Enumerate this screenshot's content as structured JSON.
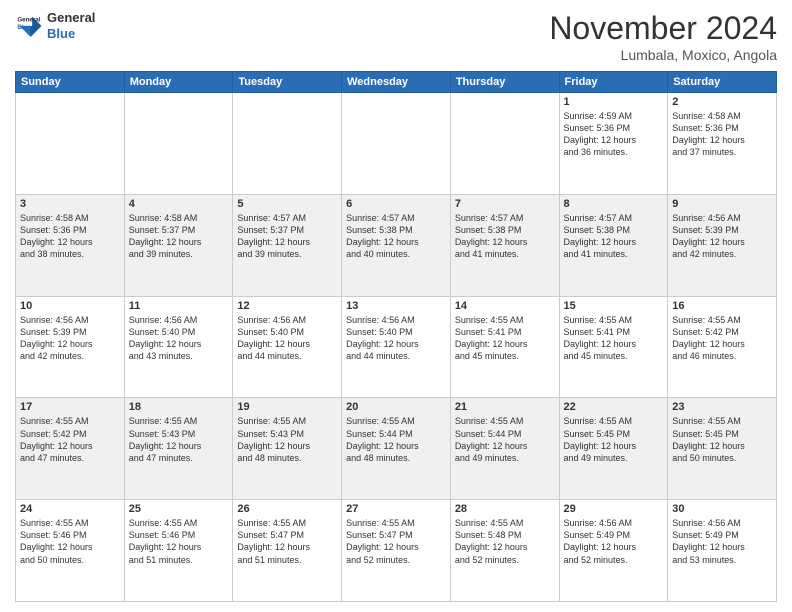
{
  "header": {
    "logo_line1": "General",
    "logo_line2": "Blue",
    "month": "November 2024",
    "location": "Lumbala, Moxico, Angola"
  },
  "weekdays": [
    "Sunday",
    "Monday",
    "Tuesday",
    "Wednesday",
    "Thursday",
    "Friday",
    "Saturday"
  ],
  "weeks": [
    [
      {
        "day": "",
        "info": ""
      },
      {
        "day": "",
        "info": ""
      },
      {
        "day": "",
        "info": ""
      },
      {
        "day": "",
        "info": ""
      },
      {
        "day": "",
        "info": ""
      },
      {
        "day": "1",
        "info": "Sunrise: 4:59 AM\nSunset: 5:36 PM\nDaylight: 12 hours\nand 36 minutes."
      },
      {
        "day": "2",
        "info": "Sunrise: 4:58 AM\nSunset: 5:36 PM\nDaylight: 12 hours\nand 37 minutes."
      }
    ],
    [
      {
        "day": "3",
        "info": "Sunrise: 4:58 AM\nSunset: 5:36 PM\nDaylight: 12 hours\nand 38 minutes."
      },
      {
        "day": "4",
        "info": "Sunrise: 4:58 AM\nSunset: 5:37 PM\nDaylight: 12 hours\nand 39 minutes."
      },
      {
        "day": "5",
        "info": "Sunrise: 4:57 AM\nSunset: 5:37 PM\nDaylight: 12 hours\nand 39 minutes."
      },
      {
        "day": "6",
        "info": "Sunrise: 4:57 AM\nSunset: 5:38 PM\nDaylight: 12 hours\nand 40 minutes."
      },
      {
        "day": "7",
        "info": "Sunrise: 4:57 AM\nSunset: 5:38 PM\nDaylight: 12 hours\nand 41 minutes."
      },
      {
        "day": "8",
        "info": "Sunrise: 4:57 AM\nSunset: 5:38 PM\nDaylight: 12 hours\nand 41 minutes."
      },
      {
        "day": "9",
        "info": "Sunrise: 4:56 AM\nSunset: 5:39 PM\nDaylight: 12 hours\nand 42 minutes."
      }
    ],
    [
      {
        "day": "10",
        "info": "Sunrise: 4:56 AM\nSunset: 5:39 PM\nDaylight: 12 hours\nand 42 minutes."
      },
      {
        "day": "11",
        "info": "Sunrise: 4:56 AM\nSunset: 5:40 PM\nDaylight: 12 hours\nand 43 minutes."
      },
      {
        "day": "12",
        "info": "Sunrise: 4:56 AM\nSunset: 5:40 PM\nDaylight: 12 hours\nand 44 minutes."
      },
      {
        "day": "13",
        "info": "Sunrise: 4:56 AM\nSunset: 5:40 PM\nDaylight: 12 hours\nand 44 minutes."
      },
      {
        "day": "14",
        "info": "Sunrise: 4:55 AM\nSunset: 5:41 PM\nDaylight: 12 hours\nand 45 minutes."
      },
      {
        "day": "15",
        "info": "Sunrise: 4:55 AM\nSunset: 5:41 PM\nDaylight: 12 hours\nand 45 minutes."
      },
      {
        "day": "16",
        "info": "Sunrise: 4:55 AM\nSunset: 5:42 PM\nDaylight: 12 hours\nand 46 minutes."
      }
    ],
    [
      {
        "day": "17",
        "info": "Sunrise: 4:55 AM\nSunset: 5:42 PM\nDaylight: 12 hours\nand 47 minutes."
      },
      {
        "day": "18",
        "info": "Sunrise: 4:55 AM\nSunset: 5:43 PM\nDaylight: 12 hours\nand 47 minutes."
      },
      {
        "day": "19",
        "info": "Sunrise: 4:55 AM\nSunset: 5:43 PM\nDaylight: 12 hours\nand 48 minutes."
      },
      {
        "day": "20",
        "info": "Sunrise: 4:55 AM\nSunset: 5:44 PM\nDaylight: 12 hours\nand 48 minutes."
      },
      {
        "day": "21",
        "info": "Sunrise: 4:55 AM\nSunset: 5:44 PM\nDaylight: 12 hours\nand 49 minutes."
      },
      {
        "day": "22",
        "info": "Sunrise: 4:55 AM\nSunset: 5:45 PM\nDaylight: 12 hours\nand 49 minutes."
      },
      {
        "day": "23",
        "info": "Sunrise: 4:55 AM\nSunset: 5:45 PM\nDaylight: 12 hours\nand 50 minutes."
      }
    ],
    [
      {
        "day": "24",
        "info": "Sunrise: 4:55 AM\nSunset: 5:46 PM\nDaylight: 12 hours\nand 50 minutes."
      },
      {
        "day": "25",
        "info": "Sunrise: 4:55 AM\nSunset: 5:46 PM\nDaylight: 12 hours\nand 51 minutes."
      },
      {
        "day": "26",
        "info": "Sunrise: 4:55 AM\nSunset: 5:47 PM\nDaylight: 12 hours\nand 51 minutes."
      },
      {
        "day": "27",
        "info": "Sunrise: 4:55 AM\nSunset: 5:47 PM\nDaylight: 12 hours\nand 52 minutes."
      },
      {
        "day": "28",
        "info": "Sunrise: 4:55 AM\nSunset: 5:48 PM\nDaylight: 12 hours\nand 52 minutes."
      },
      {
        "day": "29",
        "info": "Sunrise: 4:56 AM\nSunset: 5:49 PM\nDaylight: 12 hours\nand 52 minutes."
      },
      {
        "day": "30",
        "info": "Sunrise: 4:56 AM\nSunset: 5:49 PM\nDaylight: 12 hours\nand 53 minutes."
      }
    ]
  ],
  "colors": {
    "header_bg": "#2a6db5",
    "accent": "#2a6db5"
  }
}
